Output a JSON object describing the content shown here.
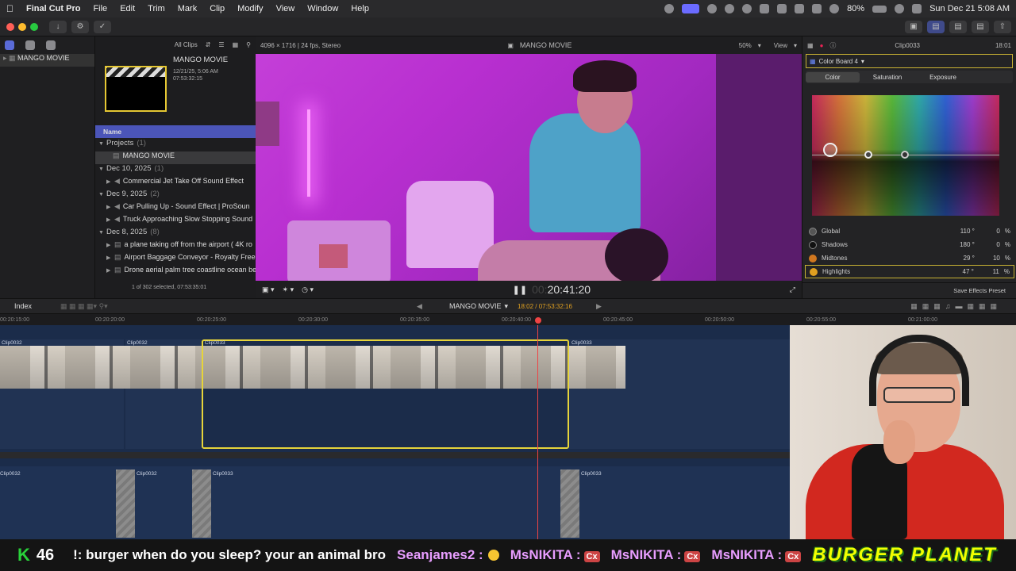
{
  "menubar": {
    "app_name": "Final Cut Pro",
    "items": [
      "File",
      "Edit",
      "Trim",
      "Mark",
      "Clip",
      "Modify",
      "View",
      "Window",
      "Help"
    ],
    "battery": "80%",
    "datetime": "Sun Dec 21  5:08 AM"
  },
  "library": {
    "name": "MANGO MOVIE"
  },
  "browser": {
    "filter": "All Clips",
    "project_card": {
      "title": "MANGO MOVIE",
      "date": "12/21/25, 5:06 AM",
      "duration": "07:53:32:15"
    },
    "column_header": "Name",
    "sections": [
      {
        "label": "Projects",
        "count": "(1)",
        "items": [
          "MANGO MOVIE"
        ]
      },
      {
        "label": "Dec 10, 2025",
        "count": "(1)",
        "items": [
          "Commercial Jet Take Off Sound Effect"
        ]
      },
      {
        "label": "Dec 9, 2025",
        "count": "(2)",
        "items": [
          "Car Pulling Up - Sound Effect  |  ProSoun",
          "Truck Approaching Slow Stopping Sound"
        ]
      },
      {
        "label": "Dec 8, 2025",
        "count": "(8)",
        "items": [
          "a plane taking off from the airport ( 4K ro",
          "Airport Baggage Conveyor - Royalty Free",
          "Drone aerial palm tree coastline ocean be"
        ]
      }
    ],
    "status": "1 of 302 selected, 07:53:35:01"
  },
  "viewer": {
    "format": "4096 × 1716 | 24 fps, Stereo",
    "title": "MANGO MOVIE",
    "zoom": "50%",
    "view_menu": "View",
    "timecode": "20:41:20",
    "timecode_prefix": "00:"
  },
  "inspector": {
    "clip_name": "Clip0033",
    "duration": "18:01",
    "effect": "Color Board 4",
    "tabs": [
      "Color",
      "Saturation",
      "Exposure"
    ],
    "controls": [
      {
        "label": "Global",
        "angle": "110 °",
        "value": "0",
        "unit": "%",
        "color": "#555555"
      },
      {
        "label": "Shadows",
        "angle": "180 °",
        "value": "0",
        "unit": "%",
        "color": "#111111"
      },
      {
        "label": "Midtones",
        "angle": "29 °",
        "value": "10",
        "unit": "%",
        "color": "#d0771f"
      },
      {
        "label": "Highlights",
        "angle": "47 °",
        "value": "11",
        "unit": "%",
        "color": "#e0a020"
      }
    ],
    "save_preset": "Save Effects Preset"
  },
  "timeline": {
    "index_label": "Index",
    "project": "MANGO MOVIE",
    "position": "18:02 / 07:53:32:16",
    "ruler": [
      "00:20:15:00",
      "00:20:20:00",
      "00:20:25:00",
      "00:20:30:00",
      "00:20:35:00",
      "00:20:40:00",
      "00:20:45:00",
      "00:20:50:00",
      "00:20:55:00",
      "00:21:00:00"
    ],
    "clips_top": [
      "Clip0032",
      "Clip0032",
      "Clip0033",
      "Clip0033"
    ],
    "clips_bottom": [
      "Clip0032",
      "Clip0032",
      "Clip0033",
      "Clip0033"
    ],
    "meter_labels": [
      "0",
      "-6"
    ]
  },
  "chat": {
    "k_label": "K",
    "k_count": "46",
    "message1": "!: burger when do you sleep? your an animal bro",
    "user2": "Seanjames2 :",
    "user3": "MsNIKITA :",
    "user4": "MsNIKITA :",
    "user5": "MsNIKITA :",
    "cx_label": "Cx",
    "brand": "BURGER PLANET"
  }
}
